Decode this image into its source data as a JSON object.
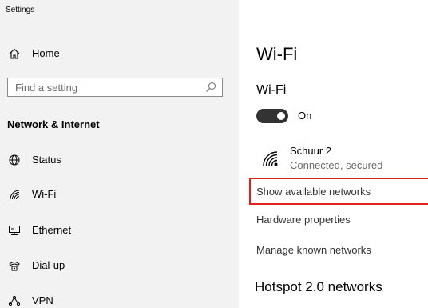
{
  "app": {
    "title": "Settings"
  },
  "sidebar": {
    "home_label": "Home",
    "search": {
      "placeholder": "Find a setting"
    },
    "section_heading": "Network & Internet",
    "items": [
      {
        "label": "Status",
        "icon": "globe-icon"
      },
      {
        "label": "Wi-Fi",
        "icon": "wifi-icon"
      },
      {
        "label": "Ethernet",
        "icon": "ethernet-icon"
      },
      {
        "label": "Dial-up",
        "icon": "dialup-icon"
      },
      {
        "label": "VPN",
        "icon": "vpn-icon"
      }
    ]
  },
  "main": {
    "title": "Wi-Fi",
    "wifi_section_label": "Wi-Fi",
    "toggle": {
      "state_label": "On",
      "on": true
    },
    "network": {
      "name": "Schuur 2",
      "status": "Connected, secured"
    },
    "links": {
      "show_available": "Show available networks",
      "hardware_properties": "Hardware properties",
      "manage_known": "Manage known networks"
    },
    "hotspot_title": "Hotspot 2.0 networks"
  },
  "colors": {
    "sidebar_bg": "#f2f2f2",
    "toggle_on": "#333333",
    "highlight_box": "#e0201c"
  }
}
